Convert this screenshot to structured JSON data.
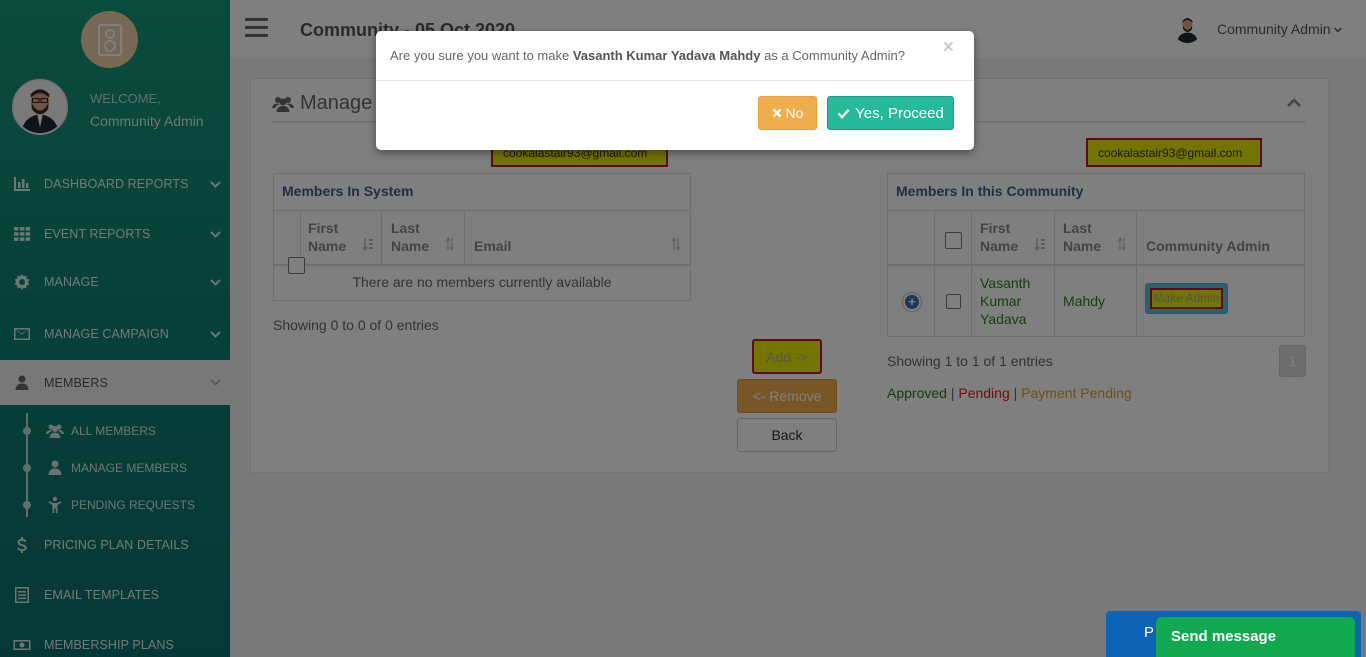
{
  "sidebar": {
    "welcome": "WELCOME,",
    "user_name": "Community Admin",
    "items": [
      {
        "label": "DASHBOARD REPORTS",
        "icon": "bar-chart-icon"
      },
      {
        "label": "EVENT REPORTS",
        "icon": "grid-icon"
      },
      {
        "label": "MANAGE",
        "icon": "gear-icon"
      },
      {
        "label": "MANAGE CAMPAIGN",
        "icon": "envelope-icon"
      },
      {
        "label": "MEMBERS",
        "icon": "user-icon"
      },
      {
        "label": "PRICING PLAN DETAILS",
        "icon": "dollar-icon"
      },
      {
        "label": "EMAIL TEMPLATES",
        "icon": "list-icon"
      },
      {
        "label": "MEMBERSHIP PLANS",
        "icon": "money-icon"
      }
    ],
    "subitems": [
      {
        "label": "ALL MEMBERS",
        "icon": "users-icon"
      },
      {
        "label": "MANAGE MEMBERS",
        "icon": "user-icon"
      },
      {
        "label": "PENDING REQUESTS",
        "icon": "person-icon"
      }
    ]
  },
  "topbar": {
    "title": "Community - 05 Oct 2020",
    "user": "Community Admin"
  },
  "panel": {
    "title": "Manage",
    "left_email": "cookalastair93@gmail.com",
    "right_email": "cookalastair93@gmail.com"
  },
  "left_table": {
    "title": "Members In System",
    "columns": [
      "First Name",
      "Last Name",
      "Email"
    ],
    "empty": "There are no members currently available",
    "info": "Showing 0 to 0 of 0 entries"
  },
  "buttons": {
    "add": "Add ->",
    "remove": "<- Remove",
    "back": "Back"
  },
  "right_table": {
    "title": "Members In this Community",
    "columns": [
      "First Name",
      "Last Name",
      "Community Admin"
    ],
    "row": {
      "first": "Vasanth Kumar Yadava",
      "last": "Mahdy",
      "action": "Make Admin"
    },
    "info": "Showing 1 to 1 of 1 entries",
    "page": "1"
  },
  "legend": {
    "approved": "Approved",
    "sep": "|",
    "pending": "Pending",
    "payment_pending": "Payment Pending"
  },
  "modal": {
    "msg_pre": "Are you sure you want to make",
    "msg_name": "Vasanth Kumar Yadava Mahdy",
    "msg_post": "as a Community Admin?",
    "close": "×",
    "no": "No",
    "yes": "Yes, Proceed"
  },
  "chat": {
    "send": "Send message",
    "behind": "P"
  },
  "colors": {
    "sidebar": "#16977b",
    "approved": "#2e7d1f",
    "pending": "#e0201c",
    "payment_pending": "#e19a35",
    "yes_button": "#26b99a",
    "no_button": "#f0ad4e"
  }
}
